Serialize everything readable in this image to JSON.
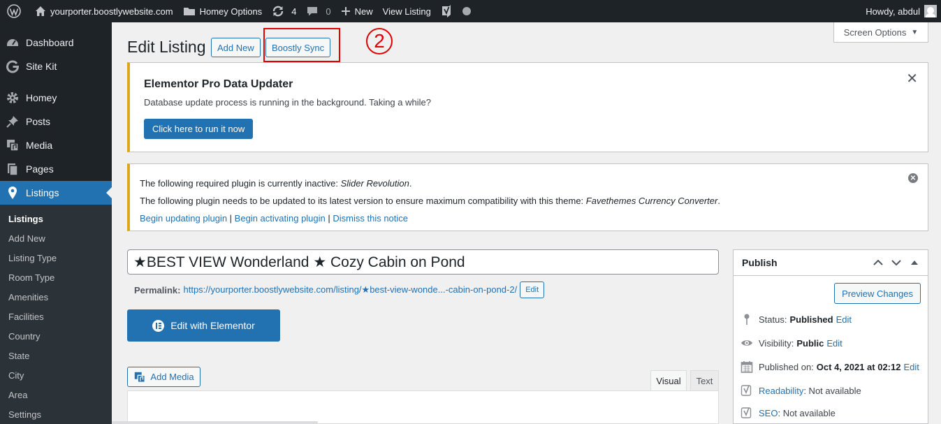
{
  "adminbar": {
    "site_name": "yourporter.boostlywebsite.com",
    "theme_options": "Homey Options",
    "updates_count": "4",
    "comments_count": "0",
    "new_label": "New",
    "view_listing": "View Listing",
    "greeting": "Howdy, abdul"
  },
  "sidebar": {
    "items": [
      {
        "label": "Dashboard",
        "icon": "dashboard-icon"
      },
      {
        "label": "Site Kit",
        "icon": "google-g-icon"
      },
      {
        "label": "Homey",
        "icon": "gear-icon"
      },
      {
        "label": "Posts",
        "icon": "pin-icon"
      },
      {
        "label": "Media",
        "icon": "media-icon"
      },
      {
        "label": "Pages",
        "icon": "pages-icon"
      },
      {
        "label": "Listings",
        "icon": "location-icon"
      }
    ],
    "submenu": [
      "Listings",
      "Add New",
      "Listing Type",
      "Room Type",
      "Amenities",
      "Facilities",
      "Country",
      "State",
      "City",
      "Area",
      "Settings"
    ]
  },
  "header": {
    "title": "Edit Listing",
    "add_new": "Add New",
    "boostly_sync": "Boostly Sync",
    "step_number": "2",
    "screen_options": "Screen Options"
  },
  "elementor_notice": {
    "title": "Elementor Pro Data Updater",
    "message": "Database update process is running in the background. Taking a while?",
    "button": "Click here to run it now"
  },
  "plugin_notice": {
    "line1_prefix": "The following required plugin is currently inactive: ",
    "line1_plugin": "Slider Revolution",
    "line1_suffix": ".",
    "line2_prefix": "The following plugin needs to be updated to its latest version to ensure maximum compatibility with this theme: ",
    "line2_plugin": "Favethemes Currency Converter",
    "line2_suffix": ".",
    "link_update": "Begin updating plugin",
    "link_activate": "Begin activating plugin",
    "link_dismiss": "Dismiss this notice",
    "separator": " | "
  },
  "editor": {
    "post_title": "★BEST VIEW Wonderland ★ Cozy Cabin on Pond",
    "permalink_label": "Permalink:",
    "permalink_url": "https://yourporter.boostlywebsite.com/listing/★best-view-wonde...-cabin-on-pond-2/",
    "permalink_edit": "Edit",
    "elementor_button": "Edit with Elementor",
    "add_media": "Add Media",
    "tab_visual": "Visual",
    "tab_text": "Text"
  },
  "publish": {
    "title": "Publish",
    "preview": "Preview Changes",
    "status_label": "Status:",
    "status_value": "Published",
    "visibility_label": "Visibility:",
    "visibility_value": "Public",
    "published_label": "Published on:",
    "published_value": "Oct 4, 2021 at 02:12",
    "edit": "Edit",
    "readability_link": "Readability",
    "readability_value": ": Not available",
    "seo_link": "SEO",
    "seo_value": ": Not available"
  }
}
